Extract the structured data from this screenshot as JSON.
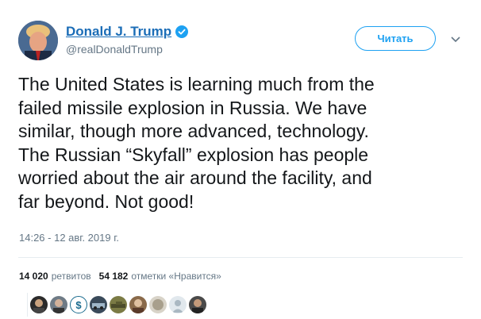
{
  "tweet": {
    "display_name": "Donald J. Trump",
    "handle": "@realDonaldTrump",
    "follow_label": "Читать",
    "text": "The United States is learning much from the\nfailed missile explosion in Russia. We have\nsimilar, though more advanced, technology.\nThe Russian “Skyfall” explosion has people\nworried about the air around the facility, and\nfar beyond. Not good!",
    "timestamp": "14:26 - 12 авг. 2019 г."
  },
  "stats": {
    "retweets_count": "14 020",
    "retweets_label": "ретвитов",
    "likes_count": "54 182",
    "likes_label": "отметки «Нравится»"
  },
  "colors": {
    "link_blue": "#1b6db7",
    "accent": "#1da1f2",
    "muted": "#657786",
    "text": "#14171a"
  },
  "icons": [
    "verified-badge-icon",
    "chevron-down-icon"
  ]
}
